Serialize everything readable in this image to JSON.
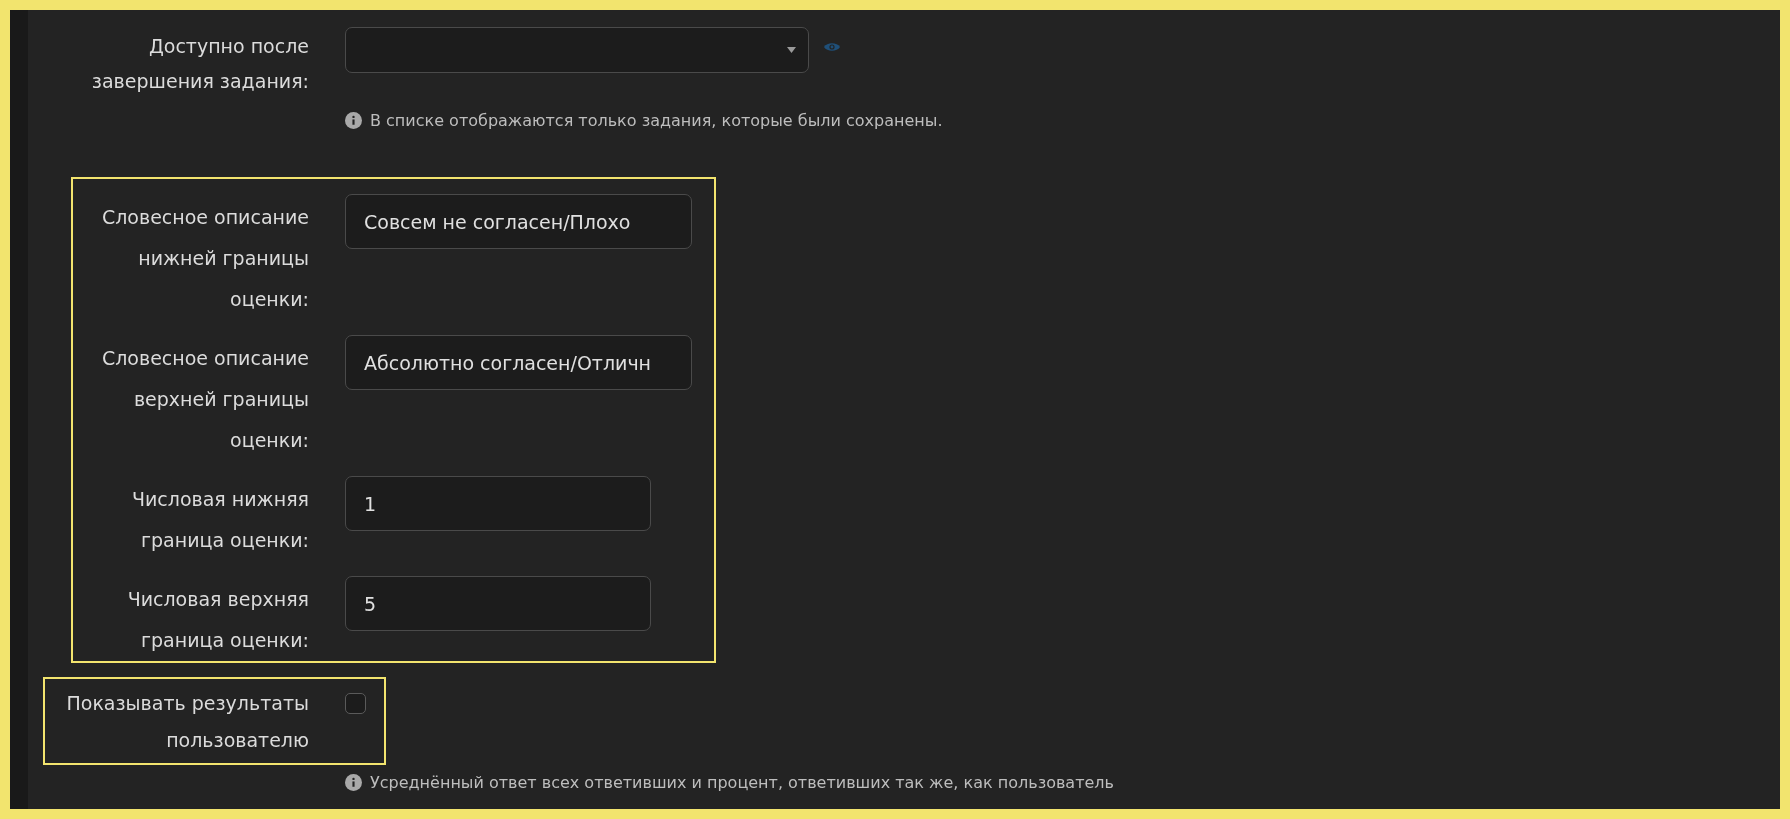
{
  "available_after": {
    "label": "Доступно после завершения задания:",
    "hint": "В списке отображаются только задания, которые были сохранены."
  },
  "scale_group": {
    "fields": [
      {
        "kind": "text",
        "label": "Словесное описание нижней границы оценки:",
        "value": "Совсем не согласен/Плохо"
      },
      {
        "kind": "text",
        "label": "Словесное описание верхней границы оценки:",
        "value": "Абсолютно согласен/Отличн"
      },
      {
        "kind": "number",
        "label": "Числовая нижняя граница оценки:",
        "value": "1"
      },
      {
        "kind": "number",
        "label": "Числовая верхняя граница оценки:",
        "value": "5"
      }
    ]
  },
  "show_results": {
    "label": "Показывать результаты пользователю",
    "checked": false,
    "hint": "Усреднённый ответ всех ответивших и процент, ответивших так же, как пользователь"
  }
}
